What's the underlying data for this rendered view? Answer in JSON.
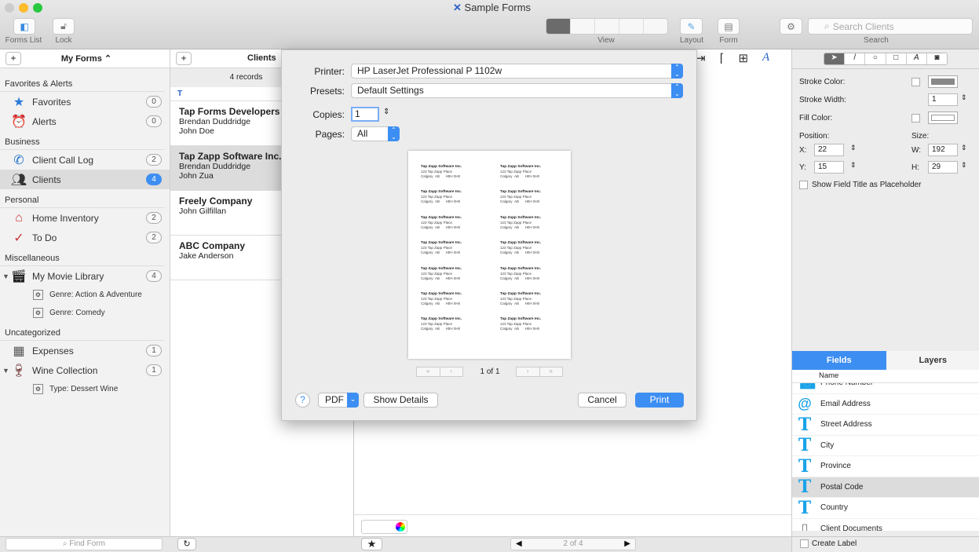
{
  "window": {
    "title": "Sample Forms"
  },
  "toolbar": {
    "forms_list": "Forms List",
    "lock": "Lock",
    "view": "View",
    "layout": "Layout",
    "form": "Form",
    "search_placeholder": "Search Clients",
    "search": "Search"
  },
  "sidebar": {
    "title": "My Forms",
    "sections": [
      {
        "label": "Favorites & Alerts",
        "items": [
          {
            "label": "Favorites",
            "count": "0",
            "icon": "star-icon"
          },
          {
            "label": "Alerts",
            "count": "0",
            "icon": "alarm-clock-icon"
          }
        ]
      },
      {
        "label": "Business",
        "items": [
          {
            "label": "Client Call Log",
            "count": "2",
            "icon": "phone-icon"
          },
          {
            "label": "Clients",
            "count": "4",
            "icon": "people-icon",
            "selected": true
          }
        ]
      },
      {
        "label": "Personal",
        "items": [
          {
            "label": "Home Inventory",
            "count": "2",
            "icon": "house-icon"
          },
          {
            "label": "To Do",
            "count": "2",
            "icon": "checklist-icon"
          }
        ]
      },
      {
        "label": "Miscellaneous",
        "items": [
          {
            "label": "My Movie Library",
            "count": "4",
            "icon": "clapperboard-icon",
            "subs": [
              "Genre: Action & Adventure",
              "Genre: Comedy"
            ]
          }
        ]
      },
      {
        "label": "Uncategorized",
        "items": [
          {
            "label": "Expenses",
            "count": "1",
            "icon": "calculator-icon"
          },
          {
            "label": "Wine Collection",
            "count": "1",
            "icon": "wine-bottles-icon",
            "subs": [
              "Type: Dessert Wine"
            ]
          }
        ]
      }
    ],
    "find_placeholder": "Find Form"
  },
  "list": {
    "title": "Clients",
    "count": "4 records",
    "section_letter": "T",
    "records": [
      {
        "name": "Tap Forms Developers",
        "l1": "Brendan Duddridge",
        "l2": "John Doe"
      },
      {
        "name": "Tap Zapp Software Inc.",
        "l1": "Brendan Duddridge",
        "l2": "John Zua",
        "selected": true
      },
      {
        "name": "Freely Company",
        "l1": "John Gilfillan",
        "l2": ""
      },
      {
        "name": "ABC Company",
        "l1": "Jake Anderson",
        "l2": ""
      }
    ]
  },
  "main": {
    "pager": "2 of 4"
  },
  "inspector": {
    "stroke_color": "Stroke Color:",
    "stroke_width": "Stroke Width:",
    "stroke_width_value": "1",
    "fill_color": "Fill Color:",
    "position": "Position:",
    "size": "Size:",
    "x_label": "X:",
    "x": "22",
    "y_label": "Y:",
    "y": "15",
    "w_label": "W:",
    "w": "192",
    "h_label": "H:",
    "h": "29",
    "placeholder_opt": "Show Field Title as Placeholder",
    "tabs": [
      "Fields",
      "Layers"
    ],
    "col_name": "Name",
    "fields": [
      {
        "label": "Phone Number",
        "icon": "phone-icon"
      },
      {
        "label": "Email Address",
        "icon": "at-icon"
      },
      {
        "label": "Street Address",
        "icon": "text-icon"
      },
      {
        "label": "City",
        "icon": "text-icon"
      },
      {
        "label": "Province",
        "icon": "text-icon"
      },
      {
        "label": "Postal Code",
        "icon": "text-icon",
        "selected": true
      },
      {
        "label": "Country",
        "icon": "text-icon"
      },
      {
        "label": "Client Documents",
        "icon": "documents-icon"
      }
    ],
    "create_label": "Create Label"
  },
  "print": {
    "printer_label": "Printer:",
    "printer": "HP LaserJet Professional P 1102w",
    "presets_label": "Presets:",
    "presets": "Default Settings",
    "copies_label": "Copies:",
    "copies": "1",
    "pages_label": "Pages:",
    "pages": "All",
    "page_indicator": "1 of 1",
    "help": "?",
    "pdf": "PDF",
    "show_details": "Show Details",
    "cancel": "Cancel",
    "print": "Print",
    "label_preview": {
      "company": "Tap Zapp Software Inc.",
      "street": "123 Tap Zapp Place",
      "city": "Calgary",
      "province": "AB",
      "postal": "H0H 0H0"
    }
  },
  "colors": {
    "accent": "#3d8ef2",
    "selection": "#dcdcdc",
    "field_icon": "#1ba3e8"
  }
}
